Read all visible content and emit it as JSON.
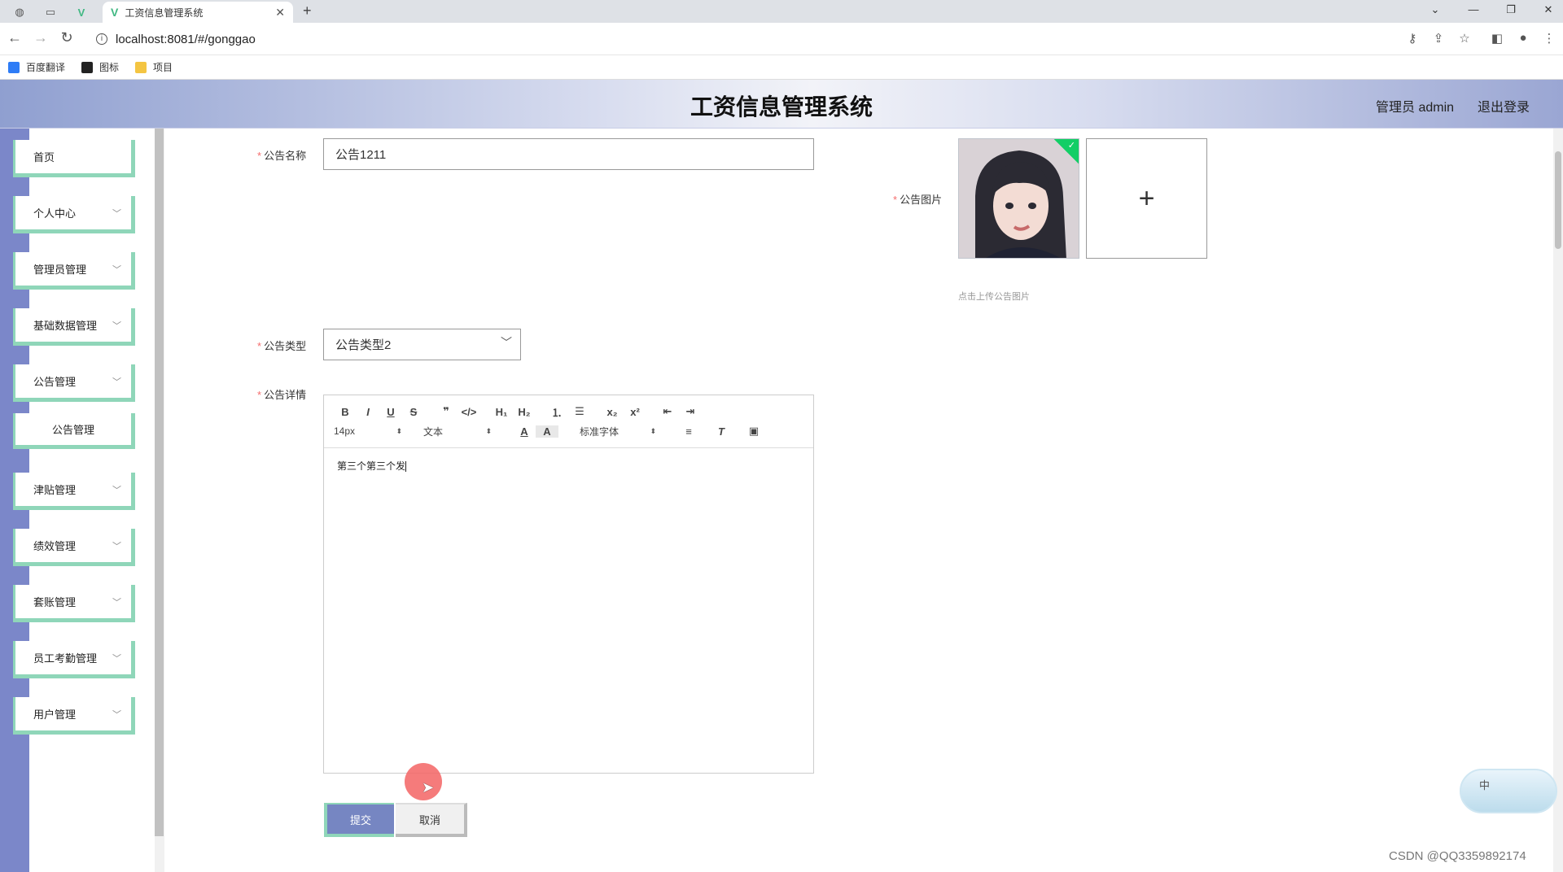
{
  "browser": {
    "tab_title": "工资信息管理系统",
    "url": "localhost:8081/#/gonggao",
    "bookmarks": [
      "百度翻译",
      "图标",
      "项目"
    ]
  },
  "header": {
    "title": "工资信息管理系统",
    "user": "管理员 admin",
    "logout": "退出登录"
  },
  "sidebar": {
    "items": [
      {
        "label": "首页"
      },
      {
        "label": "个人中心"
      },
      {
        "label": "管理员管理"
      },
      {
        "label": "基础数据管理"
      },
      {
        "label": "公告管理"
      },
      {
        "label": "公告管理"
      },
      {
        "label": "津贴管理"
      },
      {
        "label": "绩效管理"
      },
      {
        "label": "套账管理"
      },
      {
        "label": "员工考勤管理"
      },
      {
        "label": "用户管理"
      }
    ]
  },
  "form": {
    "name_label": "公告名称",
    "name_value": "公告1211",
    "image_label": "公告图片",
    "image_tip": "点击上传公告图片",
    "type_label": "公告类型",
    "type_value": "公告类型2",
    "detail_label": "公告详情",
    "editor": {
      "font_size": "14px",
      "heading": "文本",
      "font_family": "标准字体",
      "content": "第三个第三个发"
    },
    "submit": "提交",
    "cancel": "取消"
  },
  "ime": "中",
  "watermark": "CSDN @QQ3359892174",
  "colors": {
    "accent": "#7686c2",
    "menu_border": "#8fd6b9",
    "required": "#f56c6c",
    "upload_success": "#13ce66"
  }
}
